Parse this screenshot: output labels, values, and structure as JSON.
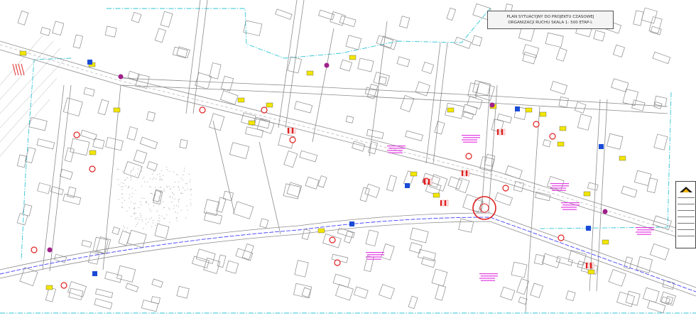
{
  "title_block": {
    "line1": "PLAN SYTUACYJNY DO PROJEKTU CZASOWEJ",
    "line2": "ORGANIZACJI RUCHU   SKALA 1: 500   ETAP-I."
  },
  "colors": {
    "boundary": "#2ec4d6",
    "street_lines": "#7a7a7a",
    "buildings": "#8a8a8a",
    "route_line": "#4040ff",
    "yellow_signs": "#f2e600",
    "annotations": "#e23ce2",
    "red_signs": "#e02020",
    "blue_signs": "#1a4bd6"
  },
  "legend": {
    "logo": "company-logo"
  }
}
